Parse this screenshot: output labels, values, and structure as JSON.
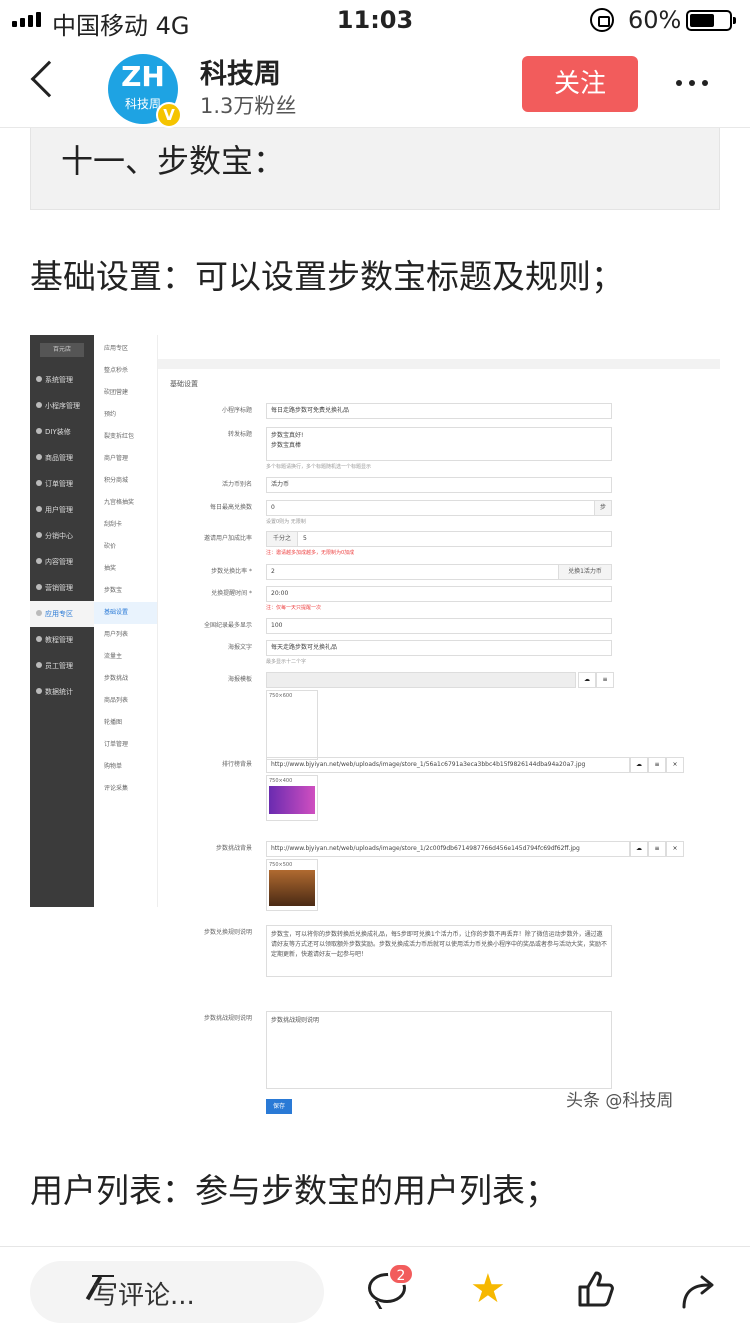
{
  "status_bar": {
    "carrier": "中国移动",
    "network": "4G",
    "time": "11:03",
    "battery": "60%"
  },
  "header": {
    "avatar_letters": "ZH",
    "avatar_sub": "科技周",
    "avatar_badge": "V",
    "name": "科技周",
    "fans": "1.3万粉丝",
    "follow_label": "关注"
  },
  "article": {
    "section_title": "十一、步数宝：",
    "para1": "基础设置：可以设置步数宝标题及规则；",
    "para2": "用户列表：参与步数宝的用户列表；",
    "watermark": "头条 @科技周"
  },
  "screenshot": {
    "sidebar_logo": "百元店",
    "sidebar": [
      "系统管理",
      "小程序管理",
      "DIY装修",
      "商品管理",
      "订单管理",
      "用户管理",
      "分销中心",
      "内容管理",
      "营销管理",
      "应用专区",
      "教程管理",
      "员工管理",
      "数据统计"
    ],
    "submenu_title": "应用专区",
    "submenu": [
      "整点秒杀",
      "砍团营建",
      "预约",
      "裂变拆红包",
      "商户管理",
      "积分商城",
      "九宫格抽奖",
      "刮刮卡",
      "砍价",
      "抽奖",
      "步数宝",
      "基础设置",
      "用户列表",
      "流量主",
      "步数挑战",
      "商品列表",
      "轮播图",
      "订单管理",
      "购物单",
      "评论采集"
    ],
    "page_title": "基础设置",
    "fields": {
      "title_label": "小程序标题",
      "title_value": "每日走路步数可免费兑换礼品",
      "share_label": "转发标题",
      "share_value1": "步数宝真好!",
      "share_value2": "步数宝真棒",
      "share_note": "多个标题请换行，多个标题随机选一个标题显示",
      "currency_label": "活力币别名",
      "currency_value": "活力币",
      "daily_label": "每日最高兑换数",
      "daily_value": "0",
      "daily_addon": "步",
      "daily_note": "设置0则为 无限制",
      "invite_label": "邀请用户加成比率",
      "invite_addon": "千分之",
      "invite_value": "5",
      "invite_note": "注：邀请越多加成越多，无限制为0加成",
      "ratio_label": "步数兑换比率 *",
      "ratio_value": "2",
      "ratio_addon": "兑换1活力币",
      "remind_label": "兑换提醒时间 *",
      "remind_value": "20:00",
      "remind_note": "注：仅每一天只提醒一次",
      "rank_label": "全国纪录最多显示",
      "rank_value": "100",
      "poster_text_label": "海报文字",
      "poster_text_value": "每天走路步数可兑换礼品",
      "poster_text_note": "最多显示十二个字",
      "poster_tpl_label": "海报模板",
      "poster_size": "750×600",
      "rank_bg_label": "排行榜背景",
      "rank_bg_value": "http://www.bjyiyan.net/web/uploads/image/store_1/56a1c6791a3eca3bbc4b15f9826144dba94a20a7.jpg",
      "rank_bg_size": "750×400",
      "challenge_bg_label": "步数挑战背景",
      "challenge_bg_value": "http://www.bjyiyan.net/web/uploads/image/store_1/2c00f9db6714987766d456e145d794fc69df62ff.jpg",
      "challenge_bg_size": "750×500",
      "rule_label": "步数兑换规则说明",
      "rule_value": "步数宝，可以将你的步数转换后兑换成礼品，每5步即可兑换1个活力币，让你的步数不再丢弃！除了微信运动步数外，通过邀请好友等方式还可以领取额外步数奖励。步数兑换成活力币后就可以使用活力币兑换小程序中的奖品或者参与活动大奖，奖励不定期更新，快邀请好友一起参与吧！",
      "challenge_rule_label": "步数挑战规则说明",
      "challenge_rule_value": "步数挑战规则说明",
      "save_label": "保存"
    }
  },
  "bottom_bar": {
    "comment_placeholder": "写评论...",
    "comment_count": "2"
  },
  "colors": {
    "follow": "#f25c5c",
    "badge": "#f25c5c",
    "star": "#f6b800",
    "avatar": "#1ea3e3"
  }
}
